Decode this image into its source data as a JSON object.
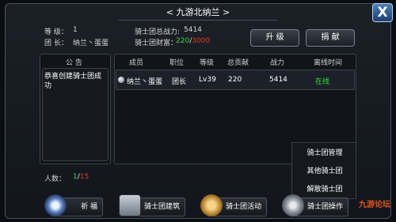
{
  "window": {
    "title": "< 九游北纳兰 >",
    "close_label": "X"
  },
  "info": {
    "level_label": "等 级：",
    "level_value": "1",
    "leader_label": "团 长：",
    "leader_value": "纳兰丶蛋蛋",
    "power_label": "骑士团总战力:",
    "power_value": "5414",
    "wealth_label": "骑士团财富：",
    "wealth_current": "220",
    "wealth_sep": "/",
    "wealth_max": "3000"
  },
  "buttons": {
    "upgrade": "升 级",
    "donate": "捐 献"
  },
  "notice": {
    "header": "公 告",
    "text": "恭喜创建骑士团成功"
  },
  "members": {
    "columns": [
      "成员",
      "职位",
      "等级",
      "总贡献",
      "战力",
      "离线时间"
    ],
    "rows": [
      {
        "name": "纳兰丶蛋蛋",
        "position": "团长",
        "level": "Lv39",
        "contribution": "220",
        "power": "5414",
        "status": "在线"
      }
    ]
  },
  "count": {
    "label": "人数：",
    "current": "1",
    "sep": "/",
    "max": "15"
  },
  "menu": {
    "items": [
      "骑士团管理",
      "其他骑士团",
      "解散骑士团"
    ]
  },
  "bottom": {
    "pray": "祈 福",
    "build": "骑士团建筑",
    "activity": "骑士团活动",
    "operate": "骑士团操作"
  },
  "watermark": "九游论坛",
  "colors": {
    "wealth_current": "#3fd13f",
    "wealth_max": "#e03a2a",
    "online": "#33e033",
    "count_current": "#3fd13f",
    "count_max": "#e03a2a"
  }
}
